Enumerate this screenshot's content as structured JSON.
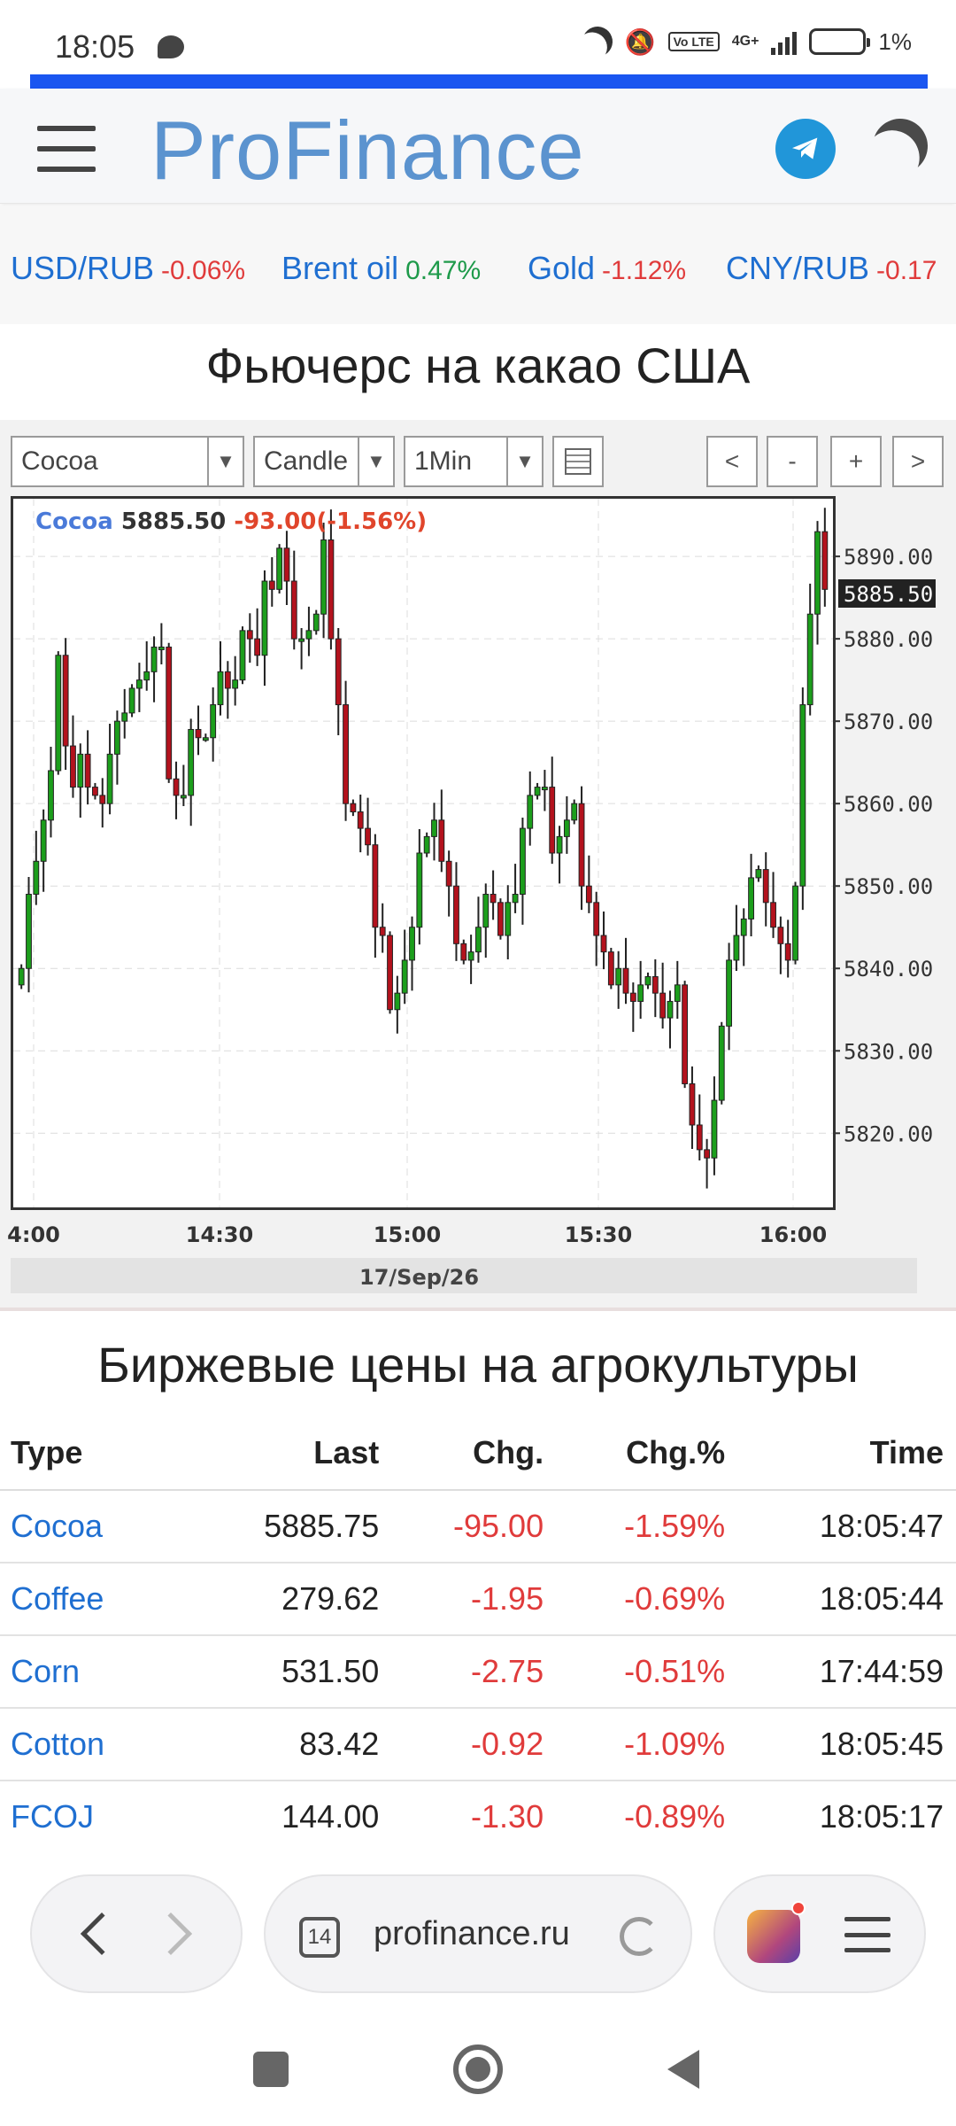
{
  "status_bar": {
    "time": "18:05",
    "network": "4G+",
    "volte": "Vo LTE",
    "battery": "1%",
    "icons": [
      "chat-bubble-icon",
      "moon-icon",
      "mute-icon",
      "volte-icon",
      "signal-icon",
      "battery-icon"
    ]
  },
  "header": {
    "logo": "ProFinance",
    "icons": [
      "hamburger-icon",
      "telegram-icon",
      "dark-mode-icon"
    ]
  },
  "ticker": [
    {
      "name": "USD/RUB",
      "change": "-0.06%",
      "trend": "down"
    },
    {
      "name": "Brent oil",
      "change": "0.47%",
      "trend": "up"
    },
    {
      "name": "Gold",
      "change": "-1.12%",
      "trend": "down"
    },
    {
      "name": "CNY/RUB",
      "change": "-0.17",
      "trend": "down"
    }
  ],
  "page_title": "Фьючерс на какао США",
  "chart_controls": {
    "instrument": "Cocoa",
    "chart_type": "Candle",
    "interval": "1Min",
    "nav_buttons": [
      "<",
      "-",
      "+",
      ">"
    ]
  },
  "chart_legend": {
    "name": "Cocoa",
    "value": "5885.50",
    "change": "-93.00(-1.56%)"
  },
  "chart_data": {
    "type": "candlestick",
    "date": "17/Sep/26",
    "x_ticks": [
      "4:00",
      "14:30",
      "15:00",
      "15:30",
      "16:00"
    ],
    "y_ticks": [
      "5890.00",
      "5880.00",
      "5870.00",
      "5860.00",
      "5850.00",
      "5840.00",
      "5830.00",
      "5820.00"
    ],
    "ylim": [
      5811,
      5897
    ],
    "last_price": "5885.50",
    "grid": true,
    "close": [
      5840,
      5849,
      5853,
      5858,
      5864,
      5878,
      5867,
      5862,
      5866,
      5862,
      5861,
      5860,
      5866,
      5870,
      5871,
      5874,
      5875,
      5876,
      5879,
      5879,
      5863,
      5861,
      5861,
      5869,
      5868,
      5868,
      5872,
      5876,
      5874,
      5875,
      5881,
      5880,
      5878,
      5887,
      5886,
      5891,
      5887,
      5880,
      5880,
      5881,
      5883,
      5892,
      5880,
      5872,
      5860,
      5859,
      5857,
      5855,
      5845,
      5844,
      5835,
      5837,
      5841,
      5845,
      5854,
      5856,
      5858,
      5853,
      5850,
      5843,
      5841,
      5842,
      5845,
      5849,
      5848,
      5844,
      5848,
      5849,
      5857,
      5861,
      5862,
      5862,
      5854,
      5856,
      5858,
      5860,
      5850,
      5848,
      5844,
      5842,
      5838,
      5840,
      5837,
      5836,
      5838,
      5839,
      5837,
      5834,
      5836,
      5838,
      5826,
      5821,
      5818,
      5817,
      5824,
      5833,
      5841,
      5844,
      5846,
      5851,
      5852,
      5848,
      5845,
      5843,
      5841,
      5850,
      5872,
      5883,
      5893,
      5886
    ]
  },
  "agro_section": {
    "title": "Биржевые цены на агрокультуры",
    "columns": [
      "Type",
      "Last",
      "Chg.",
      "Chg.%",
      "Time"
    ],
    "rows": [
      {
        "type": "Cocoa",
        "last": "5885.75",
        "chg": "-95.00",
        "chgp": "-1.59%",
        "time": "18:05:47"
      },
      {
        "type": "Coffee",
        "last": "279.62",
        "chg": "-1.95",
        "chgp": "-0.69%",
        "time": "18:05:44"
      },
      {
        "type": "Corn",
        "last": "531.50",
        "chg": "-2.75",
        "chgp": "-0.51%",
        "time": "17:44:59"
      },
      {
        "type": "Cotton",
        "last": "83.42",
        "chg": "-0.92",
        "chgp": "-1.09%",
        "time": "18:05:45"
      },
      {
        "type": "FCOJ",
        "last": "144.00",
        "chg": "-1.30",
        "chgp": "-0.89%",
        "time": "18:05:17"
      }
    ]
  },
  "browser": {
    "tab_count": "14",
    "url": "profinance.ru"
  }
}
